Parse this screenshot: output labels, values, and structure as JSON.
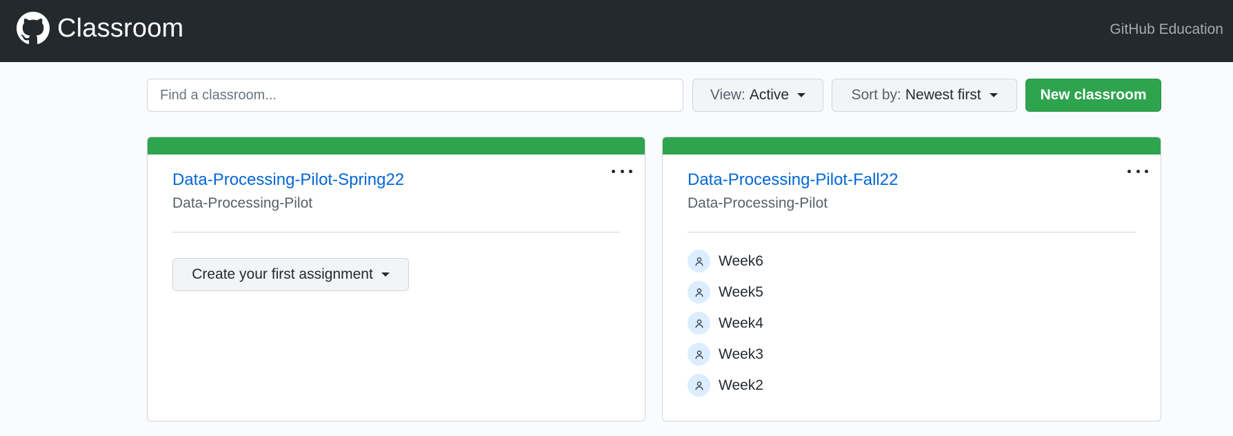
{
  "header": {
    "title": "Classroom",
    "logo_icon": "github-octocat-icon",
    "edu_link": "GitHub Education"
  },
  "toolbar": {
    "search_placeholder": "Find a classroom...",
    "view_label": "View:",
    "view_value": "Active",
    "sort_label": "Sort by:",
    "sort_value": "Newest first",
    "new_label": "New classroom"
  },
  "classrooms": [
    {
      "title": "Data-Processing-Pilot-Spring22",
      "org": "Data-Processing-Pilot",
      "cta": "Create your first assignment"
    },
    {
      "title": "Data-Processing-Pilot-Fall22",
      "org": "Data-Processing-Pilot",
      "assignments": [
        "Week6",
        "Week5",
        "Week4",
        "Week3",
        "Week2"
      ]
    }
  ],
  "colors": {
    "header_bg": "#24292e",
    "accent_green": "#2ea44f",
    "link_blue": "#0366d6"
  }
}
